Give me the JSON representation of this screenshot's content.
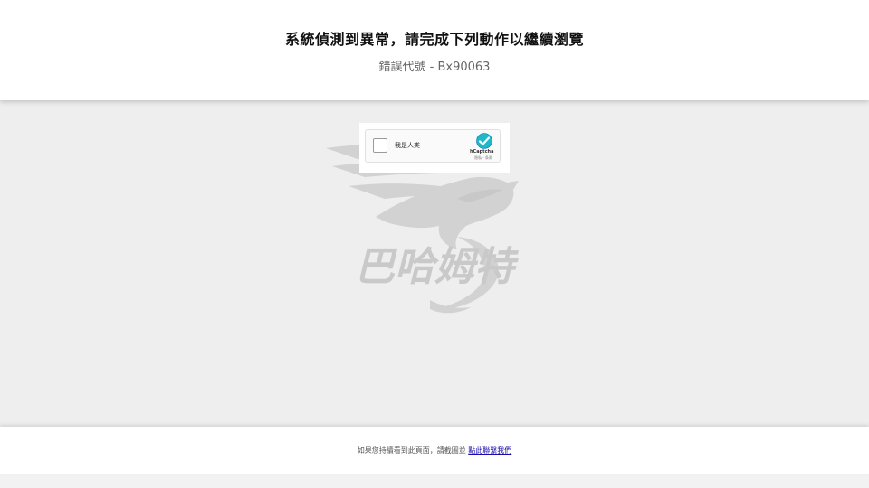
{
  "header": {
    "title": "系統偵測到異常，請完成下列動作以繼續瀏覽",
    "error_code": "錯誤代號 - Bx90063"
  },
  "watermark": {
    "brand_text": "巴哈姆特",
    "icon": "dragon-logo-icon"
  },
  "captcha": {
    "checkbox_label": "我是人类",
    "brand": "hCaptcha",
    "links": "隐私 - 条款",
    "icon": "hcaptcha-logo-icon"
  },
  "footer": {
    "message": "如果您持續看到此頁面，請截圖並",
    "link_label": "點此聯繫我們"
  },
  "colors": {
    "background": "#eeeeee",
    "panel": "#ffffff",
    "link": "#1a0dab",
    "hcaptcha_teal": "#0074bf"
  }
}
